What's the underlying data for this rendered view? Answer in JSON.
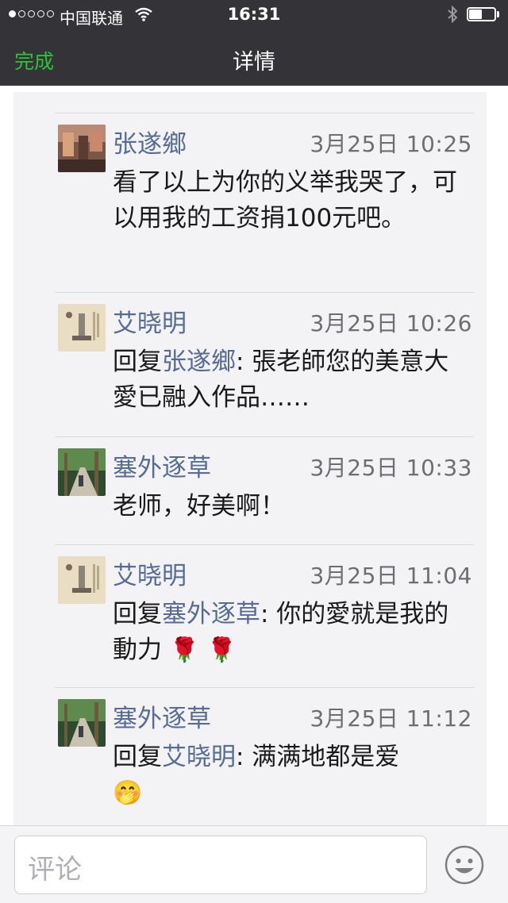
{
  "status_bar": {
    "carrier": "中国联通",
    "time": "16:31"
  },
  "nav": {
    "done_label": "完成",
    "title": "详情"
  },
  "comments": [
    {
      "author": "张遂鄉",
      "timestamp": "3月25日 10:25",
      "reply_prefix": "",
      "reply_to": "",
      "text": "看了以上为你的义举我哭了，可以用我的工资捐100元吧。",
      "emoji": ""
    },
    {
      "author": "艾晓明",
      "timestamp": "3月25日 10:26",
      "reply_prefix": "回复",
      "reply_to": "张遂鄉",
      "text": ": 張老師您的美意大愛已融入作品……",
      "emoji": ""
    },
    {
      "author": "塞外逐草",
      "timestamp": "3月25日 10:33",
      "reply_prefix": "",
      "reply_to": "",
      "text": "老师，好美啊！",
      "emoji": ""
    },
    {
      "author": "艾晓明",
      "timestamp": "3月25日 11:04",
      "reply_prefix": "回复",
      "reply_to": "塞外逐草",
      "text": ": 你的愛就是我的動力",
      "emoji": "🌹 🌹"
    },
    {
      "author": "塞外逐草",
      "timestamp": "3月25日 11:12",
      "reply_prefix": "回复",
      "reply_to": "艾晓明",
      "text": ": 满满地都是爱",
      "emoji": "🤭"
    }
  ],
  "input_bar": {
    "placeholder": "评论"
  }
}
